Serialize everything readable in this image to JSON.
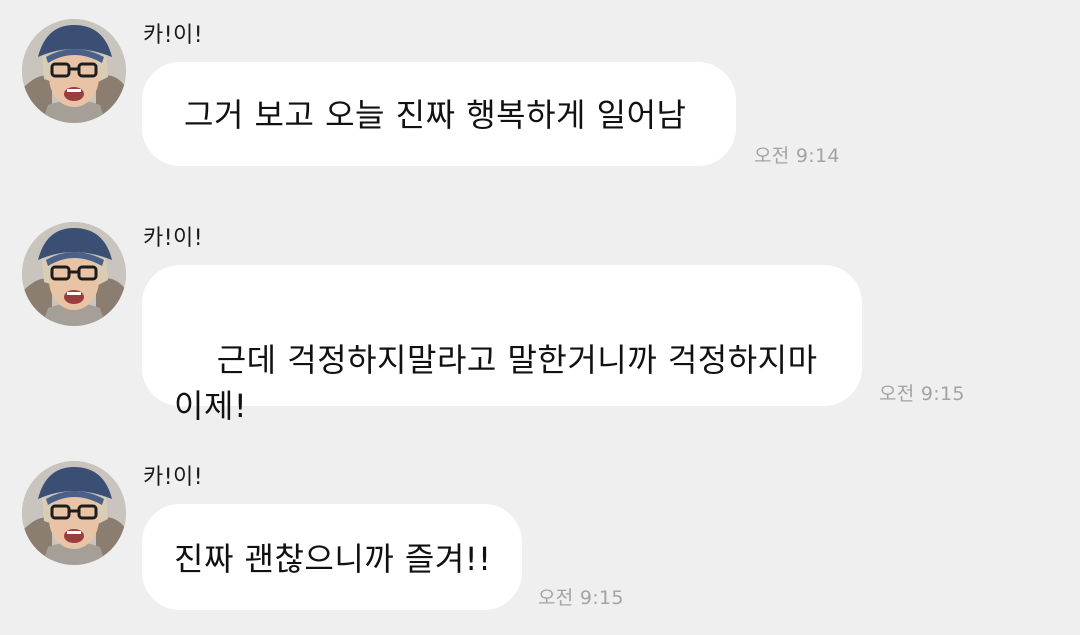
{
  "messages": [
    {
      "sender": "카!이!",
      "text": "그거 보고 오늘 진짜 행복하게 일어남",
      "time": "오전 9:14"
    },
    {
      "sender": "카!이!",
      "text": "근데 걱정하지말라고 말한거니까 걱정하지마\n이제!",
      "time": "오전 9:15"
    },
    {
      "sender": "카!이!",
      "text": "진짜 괜찮으니까 즐겨!!",
      "time": "오전 9:15"
    }
  ],
  "colors": {
    "background": "#efefef",
    "bubble": "#ffffff",
    "text": "#111111",
    "timestamp": "#a3a3a3"
  },
  "icons": {
    "avatar": "profile-photo-avatar"
  }
}
